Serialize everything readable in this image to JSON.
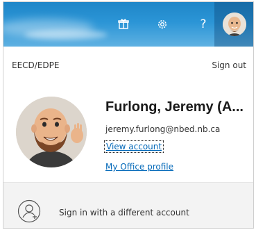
{
  "header": {
    "icons": [
      "rewards-icon",
      "settings-gear-icon",
      "help-icon",
      "avatar"
    ],
    "help_glyph": "?"
  },
  "account": {
    "organization": "EECD/EDPE",
    "sign_out_label": "Sign out",
    "display_name": "Furlong, Jeremy (A...",
    "email": "jeremy.furlong@nbed.nb.ca",
    "view_account_label": "View account",
    "office_profile_label": "My Office profile"
  },
  "footer": {
    "sign_in_different_label": "Sign in with a different account"
  },
  "colors": {
    "header_blue": "#2b95d6",
    "link_blue": "#0067b8",
    "footer_gray": "#f3f3f3"
  }
}
